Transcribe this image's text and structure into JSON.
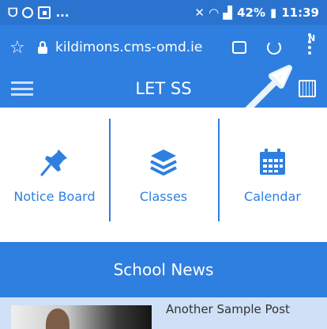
{
  "status_bar": {
    "left_text": "...",
    "battery": "42%",
    "time": "11:39",
    "icons": [
      "sim-icon",
      "face-icon",
      "square-icon",
      "mute-icon",
      "wifi-icon",
      "signal-icon",
      "battery-icon"
    ]
  },
  "browser": {
    "url": "kildimons.cms-omd.ie",
    "notification_badge": "N"
  },
  "header": {
    "title": "LET SS"
  },
  "tiles": [
    {
      "label": "Notice Board",
      "icon": "pin-icon"
    },
    {
      "label": "Classes",
      "icon": "layers-icon"
    },
    {
      "label": "Calendar",
      "icon": "calendar-icon"
    }
  ],
  "news": {
    "heading": "School News",
    "first_post_title": "Another Sample Post"
  },
  "colors": {
    "primary": "#2f7fe0",
    "badge": "#f05a22",
    "card_bg": "#cfe0f7"
  }
}
